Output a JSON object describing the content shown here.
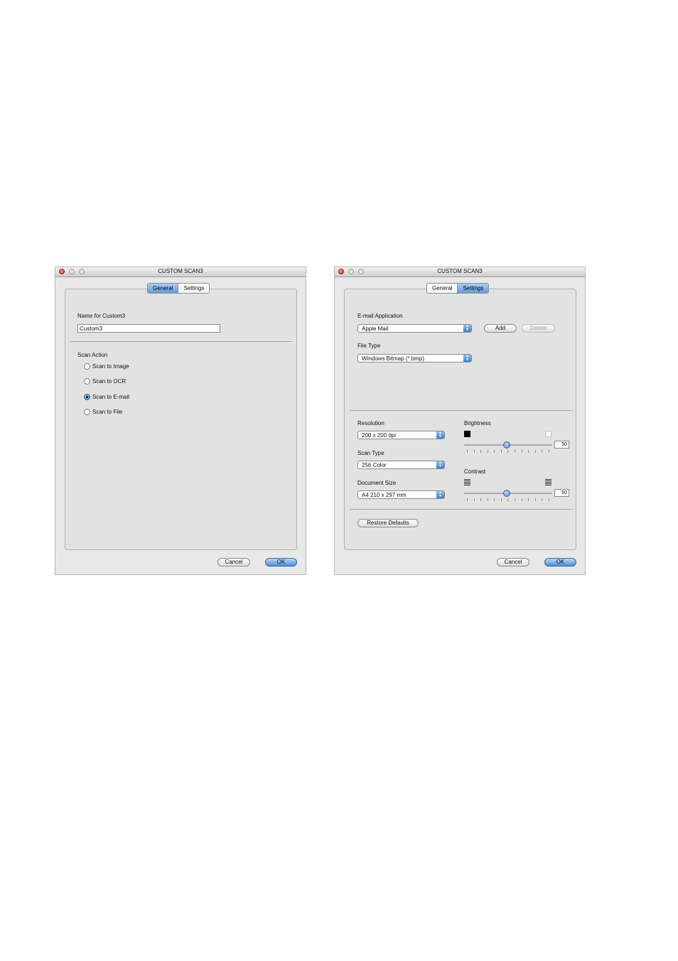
{
  "window1": {
    "title": "CUSTOM SCAN3",
    "tabs": [
      {
        "label": "General",
        "selected": true
      },
      {
        "label": "Settings",
        "selected": false
      }
    ],
    "name_label": "Name for Custom3",
    "name_value": "Custom3",
    "scan_action_label": "Scan Action",
    "scan_actions": [
      {
        "label": "Scan to Image",
        "selected": false
      },
      {
        "label": "Scan to OCR",
        "selected": false
      },
      {
        "label": "Scan to E-mail",
        "selected": true
      },
      {
        "label": "Scan to File",
        "selected": false
      }
    ],
    "cancel_label": "Cancel",
    "ok_label": "OK"
  },
  "window2": {
    "title": "CUSTOM SCAN3",
    "tabs": [
      {
        "label": "General",
        "selected": false
      },
      {
        "label": "Settings",
        "selected": true
      }
    ],
    "email_app_label": "E-mail Application",
    "email_app_value": "Apple Mail",
    "add_label": "Add",
    "delete_label": "Delete",
    "file_type_label": "File Type",
    "file_type_value": "Windows Bitmap (*.bmp)",
    "resolution_label": "Resolution",
    "resolution_value": "200 x 200 dpi",
    "scan_type_label": "Scan Type",
    "scan_type_value": "256 Color",
    "document_size_label": "Document Size",
    "document_size_value": "A4 210 x 297 mm",
    "brightness_label": "Brightness",
    "brightness_value": "50",
    "contrast_label": "Contrast",
    "contrast_value": "50",
    "restore_defaults_label": "Restore Defaults",
    "cancel_label": "Cancel",
    "ok_label": "OK"
  },
  "colors": {
    "accent": "#4a8ee0",
    "selected_tab": "#5f9ee0",
    "close_button": "#d8291c"
  }
}
